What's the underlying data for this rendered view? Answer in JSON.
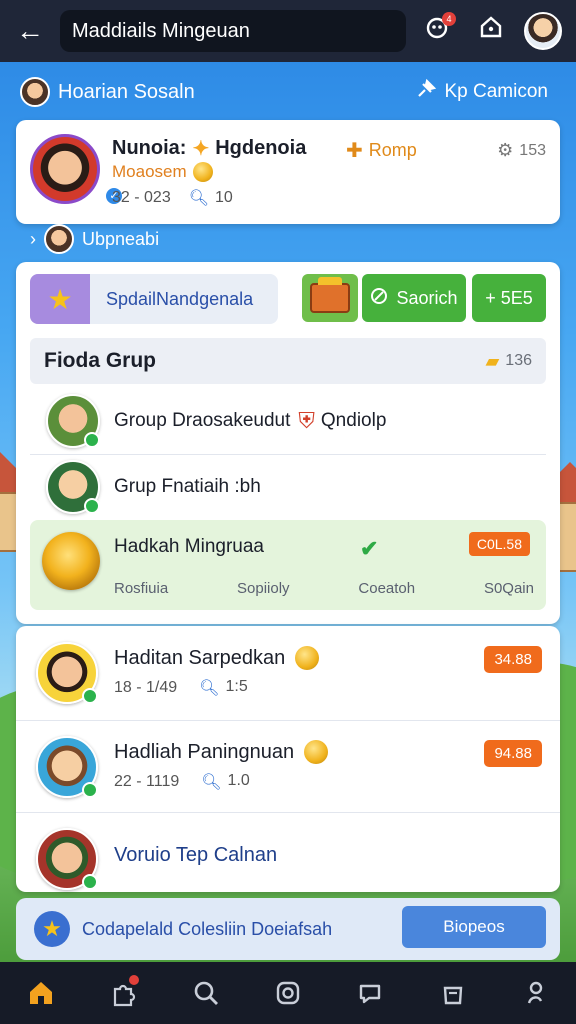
{
  "header": {
    "back_icon": "arrow-left-icon",
    "title": "Maddiails Mingeuan",
    "notif_count": "4"
  },
  "strip": {
    "left_label": "Hoarian Sosaln",
    "right_label": "Kp Camicon"
  },
  "profile": {
    "name": "Nunoia:",
    "name_suffix": "Hgdenoia",
    "subtitle": "Moaosem",
    "stat1": "32 - 023",
    "stat2": "10",
    "romp_label": "Romp",
    "count": "153"
  },
  "sub_strip": {
    "label": "Ubpneabi"
  },
  "panel": {
    "special_label": "SpdailNandgenala",
    "search_button": "Saorich",
    "add_button": "+ 5E5",
    "section_title": "Fioda Grup",
    "section_count": "136",
    "rows": [
      {
        "name": "Group Draosakeudut",
        "tag": "Qndiolp"
      },
      {
        "name": "Grup Fnatiaih :bh"
      }
    ],
    "highlight": {
      "name": "Hadkah Mingruaa",
      "badge": "C0L.58",
      "stats": [
        "Rosfiuia",
        "Sopiioly",
        "Coeatoh",
        "S0Qain"
      ]
    }
  },
  "lower": {
    "items": [
      {
        "name": "Haditan Sarpedkan",
        "meta1": "18 - 1/49",
        "meta2": "1:5",
        "badge": "34.88"
      },
      {
        "name": "Hadliah Paningnuan",
        "meta1": "22 - 1119",
        "meta2": "1.0",
        "badge": "94.88"
      },
      {
        "name": "Voruio Tep Calnan"
      }
    ]
  },
  "banner": {
    "text": "Codapelald Colesliin Doeiafsah",
    "button": "Biopeos"
  },
  "nav": {
    "items": [
      "home-icon",
      "puzzle-icon",
      "search-icon",
      "instagram-icon",
      "chat-icon",
      "bag-icon",
      "profile-icon"
    ]
  },
  "colors": {
    "accent_green": "#46b13c",
    "accent_orange": "#f06b1c",
    "accent_blue": "#4a86dc",
    "header_bg": "#1f2638"
  }
}
